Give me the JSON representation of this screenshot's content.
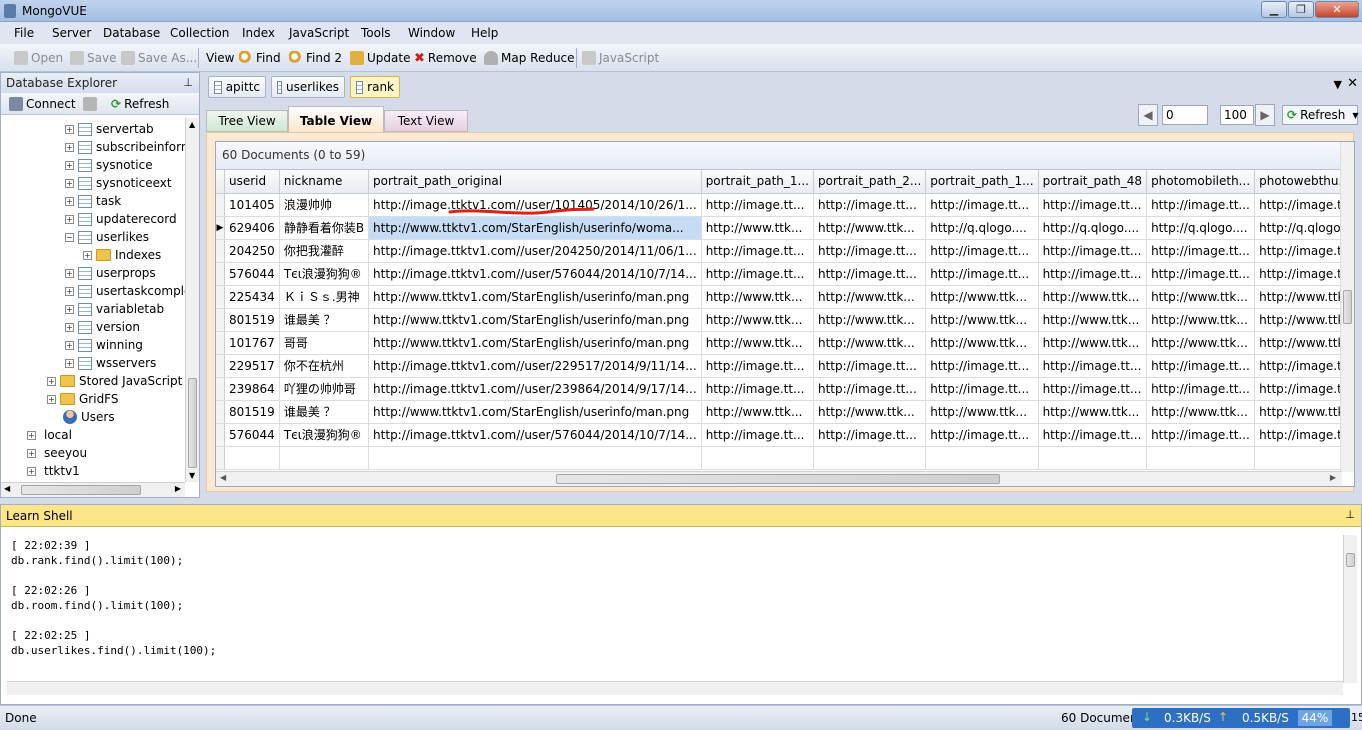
{
  "window": {
    "title": "MongoVUE",
    "minimize": "▁",
    "maximize": "❐",
    "close": "✕"
  },
  "menu": [
    "File",
    "Server",
    "Database",
    "Collection",
    "Index",
    "JavaScript",
    "Tools",
    "Window",
    "Help"
  ],
  "toolbar": {
    "open": "Open",
    "save": "Save",
    "save_as": "Save As...",
    "view": "View",
    "find": "Find",
    "find2": "Find 2",
    "update": "Update",
    "remove": "Remove",
    "map_reduce": "Map Reduce",
    "javascript": "JavaScript"
  },
  "db_explorer": {
    "title": "Database Explorer",
    "pin": "⊥",
    "connect": "Connect",
    "refresh": "Refresh",
    "items": [
      {
        "label": "servertab"
      },
      {
        "label": "subscribeinforn"
      },
      {
        "label": "sysnotice"
      },
      {
        "label": "sysnoticeext"
      },
      {
        "label": "task"
      },
      {
        "label": "updaterecord"
      },
      {
        "label": "userlikes"
      },
      {
        "label": "Indexes"
      },
      {
        "label": "userprops"
      },
      {
        "label": "usertaskcomple"
      },
      {
        "label": "variabletab"
      },
      {
        "label": "version"
      },
      {
        "label": "winning"
      },
      {
        "label": "wsservers"
      },
      {
        "label": "Stored JavaScript"
      },
      {
        "label": "GridFS"
      },
      {
        "label": "Users"
      },
      {
        "label": "local"
      },
      {
        "label": "seeyou"
      },
      {
        "label": "ttktv1"
      }
    ]
  },
  "doc_tabs": [
    "apittc",
    "userlikes",
    "rank"
  ],
  "view_tabs": {
    "tree": "Tree View",
    "table": "Table View",
    "text": "Text View"
  },
  "paging": {
    "skip": "0",
    "limit": "100",
    "refresh": "Refresh"
  },
  "grid": {
    "caption": "60 Documents (0 to 59)",
    "columns": [
      "userid",
      "nickname",
      "portrait_path_original",
      "portrait_path_1...",
      "portrait_path_2...",
      "portrait_path_1...",
      "portrait_path_48",
      "photomobileth...",
      "photowebthu..."
    ],
    "rows": [
      [
        "101405",
        "浪漫帅帅",
        "http://image.ttktv1.com//user/101405/2014/10/26/1...",
        "http://image.tt...",
        "http://image.tt...",
        "http://image.tt...",
        "http://image.tt...",
        "http://image.tt...",
        "http://image.tt..."
      ],
      [
        "629406",
        "静静看着你装B",
        "http://www.ttktv1.com/StarEnglish/userinfo/woma...",
        "http://www.ttk...",
        "http://www.ttk...",
        "http://q.qlogo....",
        "http://q.qlogo....",
        "http://q.qlogo....",
        "http://q.qlogo...."
      ],
      [
        "204250",
        "你把我灌醉",
        "http://image.ttktv1.com//user/204250/2014/11/06/1...",
        "http://image.tt...",
        "http://image.tt...",
        "http://image.tt...",
        "http://image.tt...",
        "http://image.tt...",
        "http://image.tt..."
      ],
      [
        "576044",
        "Tєι浪漫狗狗®",
        "http://image.ttktv1.com//user/576044/2014/10/7/14...",
        "http://image.tt...",
        "http://image.tt...",
        "http://image.tt...",
        "http://image.tt...",
        "http://image.tt...",
        "http://image.tt..."
      ],
      [
        "225434",
        "ＫｉＳｓ.男神",
        "http://www.ttktv1.com/StarEnglish/userinfo/man.png",
        "http://www.ttk...",
        "http://www.ttk...",
        "http://www.ttk...",
        "http://www.ttk...",
        "http://www.ttk...",
        "http://www.ttk..."
      ],
      [
        "801519",
        "谁最美 ？",
        "http://www.ttktv1.com/StarEnglish/userinfo/man.png",
        "http://www.ttk...",
        "http://www.ttk...",
        "http://www.ttk...",
        "http://www.ttk...",
        "http://www.ttk...",
        "http://www.ttk..."
      ],
      [
        "101767",
        "哥哥",
        "http://www.ttktv1.com/StarEnglish/userinfo/man.png",
        "http://www.ttk...",
        "http://www.ttk...",
        "http://www.ttk...",
        "http://www.ttk...",
        "http://www.ttk...",
        "http://www.ttk..."
      ],
      [
        "229517",
        "你不在杭州",
        "http://image.ttktv1.com//user/229517/2014/9/11/14...",
        "http://image.tt...",
        "http://image.tt...",
        "http://image.tt...",
        "http://image.tt...",
        "http://image.tt...",
        "http://image.tt..."
      ],
      [
        "239864",
        "吖狸の帅帅哥",
        "http://image.ttktv1.com//user/239864/2014/9/17/14...",
        "http://image.tt...",
        "http://image.tt...",
        "http://image.tt...",
        "http://image.tt...",
        "http://image.tt...",
        "http://image.tt..."
      ],
      [
        "801519",
        "谁最美 ？",
        "http://www.ttktv1.com/StarEnglish/userinfo/man.png",
        "http://www.ttk...",
        "http://www.ttk...",
        "http://www.ttk...",
        "http://www.ttk...",
        "http://www.ttk...",
        "http://www.ttk..."
      ],
      [
        "576044",
        "Tєι浪漫狗狗®",
        "http://image.ttktv1.com//user/576044/2014/10/7/14...",
        "http://image.tt...",
        "http://image.tt...",
        "http://image.tt...",
        "http://image.tt...",
        "http://image.tt...",
        "http://image.tt..."
      ]
    ]
  },
  "shell": {
    "title": "Learn Shell",
    "pin": "⊥",
    "lines": [
      "[ 22:02:39 ]",
      "db.rank.find().limit(100);",
      "",
      "[ 22:02:26 ]",
      "db.room.find().limit(100);",
      "",
      "[ 22:02:25 ]",
      "db.userlikes.find().limit(100);"
    ]
  },
  "status": {
    "text": "Done",
    "docs": "60 Documen",
    "down": "0.3KB/S",
    "up": "0.5KB/S",
    "cpu": "44%",
    "tail": "15"
  },
  "colors": {
    "selected_row": "#c6dcf5",
    "annotation": "#e0201a",
    "active_tab": "#fff4c4"
  }
}
